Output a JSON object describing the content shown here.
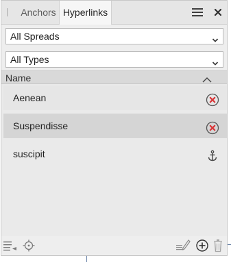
{
  "tabs": {
    "anchors": "Anchors",
    "hyperlinks": "Hyperlinks",
    "active": "Hyperlinks"
  },
  "filters": {
    "spreads": {
      "selected": "All Spreads"
    },
    "types": {
      "selected": "All Types"
    }
  },
  "list": {
    "header": "Name",
    "items": [
      {
        "label": "Aenean",
        "icon": "error-circle-x-icon"
      },
      {
        "label": "Suspendisse",
        "icon": "error-circle-x-icon",
        "selected": true
      },
      {
        "label": "suscipit",
        "icon": "anchor-icon"
      }
    ]
  },
  "colors": {
    "panel_bg": "#eeeeee",
    "selected_row": "#d5d5d5",
    "error_red": "#d9383a",
    "icon_gray": "#555555"
  }
}
